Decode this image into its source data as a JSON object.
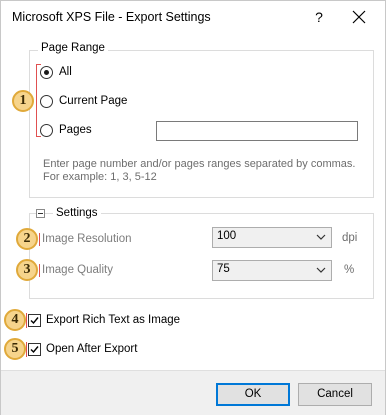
{
  "window": {
    "title": "Microsoft XPS File - Export Settings",
    "help_label": "?"
  },
  "page_range": {
    "title": "Page Range",
    "options": [
      {
        "label": "All",
        "selected": true
      },
      {
        "label": "Current Page",
        "selected": false
      },
      {
        "label": "Pages",
        "selected": false
      }
    ],
    "pages_value": "",
    "hint_line1": "Enter page number and/or pages ranges separated by commas.",
    "hint_line2": "For example: 1, 3, 5-12"
  },
  "settings": {
    "title": "Settings",
    "image_resolution": {
      "label": "Image Resolution",
      "value": "100",
      "unit": "dpi"
    },
    "image_quality": {
      "label": "Image Quality",
      "value": "75",
      "unit": "%"
    }
  },
  "options": {
    "export_rich_text": {
      "label": "Export Rich Text as Image",
      "checked": true
    },
    "open_after_export": {
      "label": "Open After Export",
      "checked": true
    }
  },
  "callouts": [
    "1",
    "2",
    "3",
    "4",
    "5"
  ],
  "buttons": {
    "ok": "OK",
    "cancel": "Cancel"
  },
  "colors": {
    "callout_fill": "#f6d48c",
    "callout_border": "#e0a93a",
    "marker": "#e05050",
    "default_button_border": "#0078d7"
  },
  "icons": {
    "close": "close-icon",
    "collapse": "collapse-minus-icon",
    "dropdown": "chevron-down-icon",
    "check": "check-icon"
  }
}
